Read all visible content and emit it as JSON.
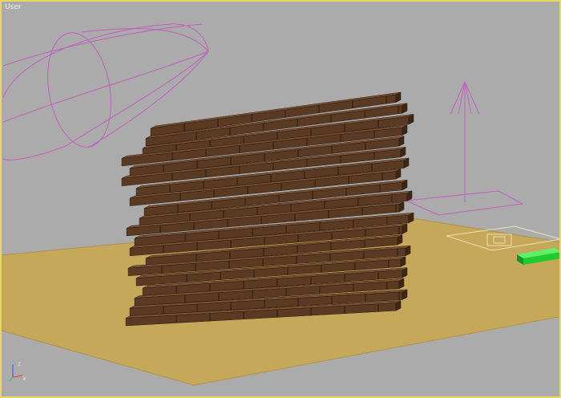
{
  "viewport": {
    "label": "User",
    "axis_labels": {
      "z": "z",
      "x": "x"
    },
    "colors": {
      "background": "#ababab",
      "frame": "#e8d860",
      "ground": "#c5a85a",
      "brick": "#5a3a22",
      "brick_top": "#7a5034",
      "brick_side": "#3d2614",
      "helper_wire": "#c060c0",
      "selected_wire": "#f0e0b0",
      "green_box": "#1ecb2a"
    },
    "objects": [
      {
        "name": "camera-cone",
        "icon": "camera-icon"
      },
      {
        "name": "brick-wall",
        "icon": "wall-icon"
      },
      {
        "name": "light-helper",
        "icon": "light-icon"
      },
      {
        "name": "target-helper",
        "icon": "target-icon"
      },
      {
        "name": "green-box",
        "icon": "box-icon"
      }
    ]
  }
}
